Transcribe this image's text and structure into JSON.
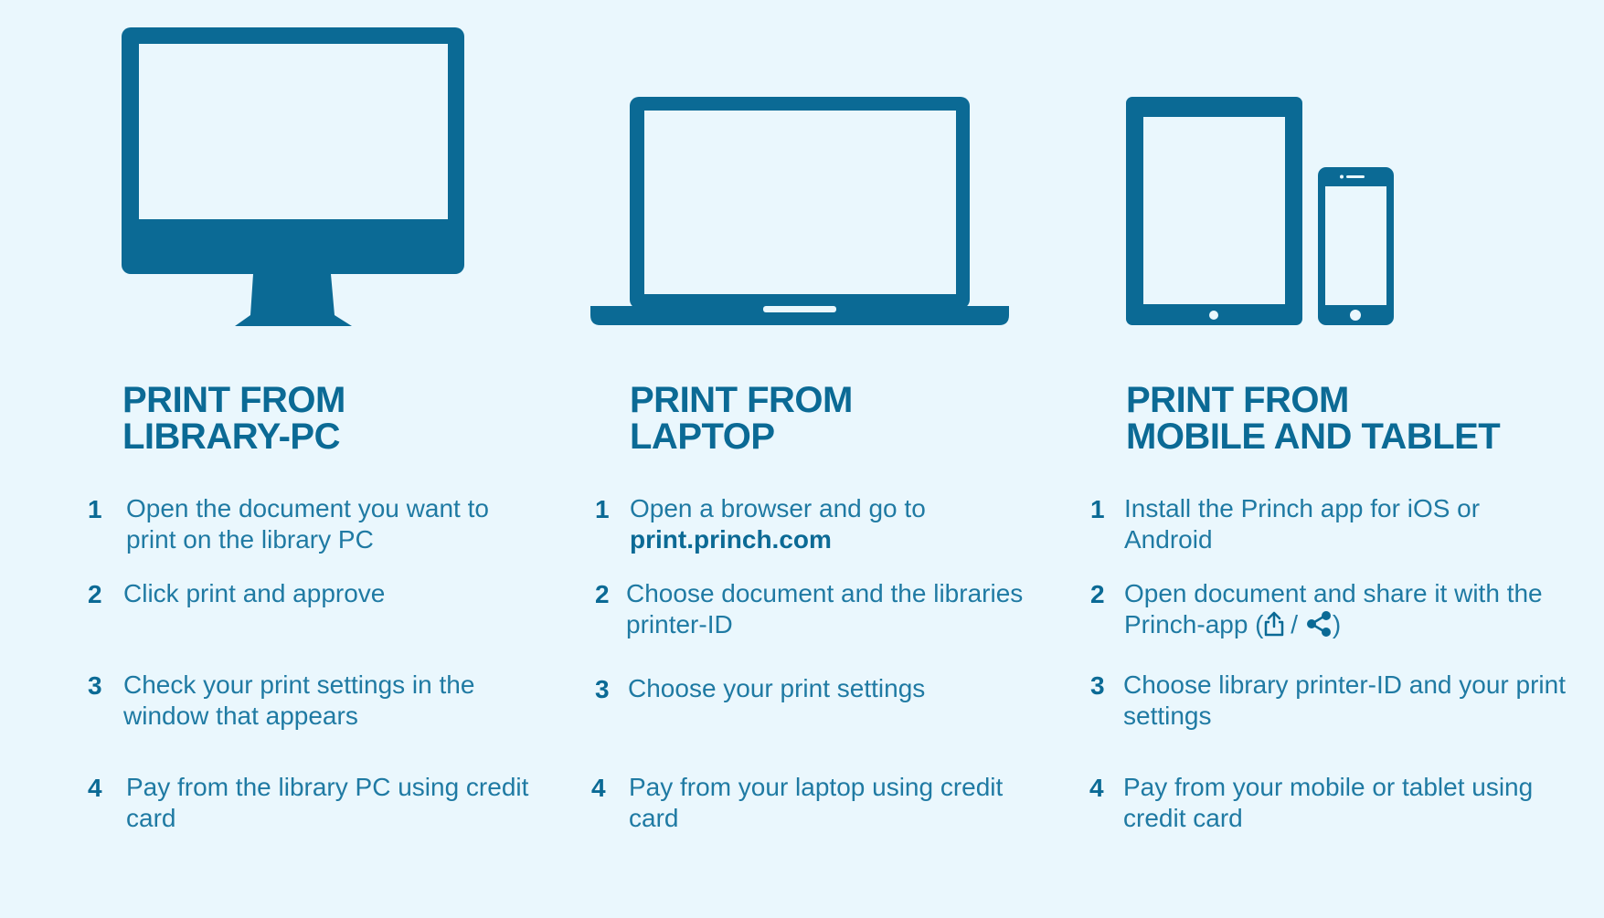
{
  "colors": {
    "background": "#eaf7fd",
    "primary": "#0b6a95",
    "text": "#1f7aa3"
  },
  "columns": [
    {
      "id": "library-pc",
      "icon": "desktop-monitor-icon",
      "title_line1": "PRINT FROM",
      "title_line2": "LIBRARY-PC",
      "steps": [
        {
          "num": "1",
          "text": "Open the document you want to print on the library PC"
        },
        {
          "num": "2",
          "text": "Click print and approve"
        },
        {
          "num": "3",
          "text": "Check your print settings in the window that appears"
        },
        {
          "num": "4",
          "text": "Pay from the library PC using credit card"
        }
      ]
    },
    {
      "id": "laptop",
      "icon": "laptop-icon",
      "title_line1": "PRINT FROM",
      "title_line2": "LAPTOP",
      "steps": [
        {
          "num": "1",
          "text": "Open a browser and go to",
          "link": "print.princh.com"
        },
        {
          "num": "2",
          "text": "Choose document and the libraries printer-ID"
        },
        {
          "num": "3",
          "text": "Choose your print settings"
        },
        {
          "num": "4",
          "text": "Pay from your laptop using credit card"
        }
      ]
    },
    {
      "id": "mobile-tablet",
      "icon": "tablet-and-phone-icon",
      "title_line1": "PRINT FROM",
      "title_line2": "MOBILE AND TABLET",
      "steps": [
        {
          "num": "1",
          "text": "Install the Princh app for iOS or Android"
        },
        {
          "num": "2",
          "text_before": "Open document and share it with the Princh-app (",
          "separator": "/",
          "text_after": ")",
          "icons": [
            "ios-share-icon",
            "android-share-icon"
          ]
        },
        {
          "num": "3",
          "text": "Choose library printer-ID and your print settings"
        },
        {
          "num": "4",
          "text": "Pay from your mobile or tablet using credit card"
        }
      ]
    }
  ]
}
